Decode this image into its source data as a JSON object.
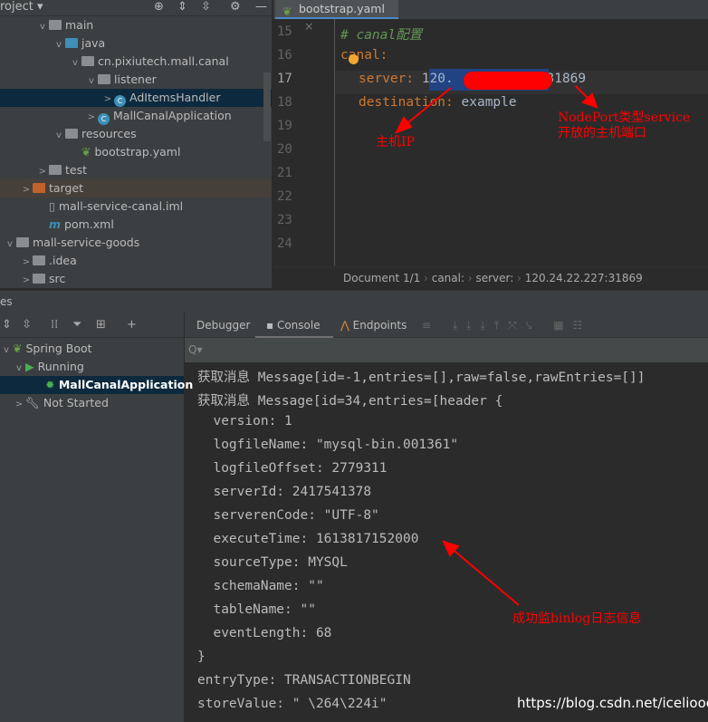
{
  "project": {
    "header": "roject",
    "tree": [
      {
        "label": "main",
        "indent": 40,
        "chev": "v",
        "icon": "folder"
      },
      {
        "label": "java",
        "indent": 58,
        "chev": "v",
        "icon": "folder-blue"
      },
      {
        "label": "cn.pixiutech.mall.canal",
        "indent": 76,
        "chev": "v",
        "icon": "package"
      },
      {
        "label": "listener",
        "indent": 94,
        "chev": "v",
        "icon": "package"
      },
      {
        "label": "AdItemsHandler",
        "indent": 112,
        "chev": ">",
        "icon": "class"
      },
      {
        "label": "MallCanalApplication",
        "indent": 94,
        "chev": ">",
        "icon": "spring-class"
      },
      {
        "label": "resources",
        "indent": 58,
        "chev": "v",
        "icon": "folder"
      },
      {
        "label": "bootstrap.yaml",
        "indent": 76,
        "chev": "",
        "icon": "yaml"
      },
      {
        "label": "test",
        "indent": 40,
        "chev": ">",
        "icon": "folder"
      },
      {
        "label": "target",
        "indent": 22,
        "chev": ">",
        "icon": "folder-orange"
      },
      {
        "label": "mall-service-canal.iml",
        "indent": 40,
        "chev": "",
        "icon": "iml"
      },
      {
        "label": "pom.xml",
        "indent": 40,
        "chev": "",
        "icon": "maven"
      },
      {
        "label": "mall-service-goods",
        "indent": 4,
        "chev": "v",
        "icon": "folder"
      },
      {
        "label": ".idea",
        "indent": 22,
        "chev": ">",
        "icon": "folder"
      },
      {
        "label": "src",
        "indent": 22,
        "chev": ">",
        "icon": "folder"
      }
    ]
  },
  "editor": {
    "tab": "bootstrap.yaml",
    "line_numbers": [
      "15",
      "16",
      "17",
      "18",
      "19",
      "20",
      "21",
      "22",
      "23",
      "24"
    ],
    "comment": "# canal配置",
    "key_canal": "canal:",
    "key_server": "server:",
    "server_visible": "120.",
    "server_port": ":31869",
    "key_destination": "destination:",
    "destination": "example",
    "breadcrumb": [
      "Document 1/1",
      "canal:",
      "server:",
      "120.24.22.227:31869"
    ]
  },
  "annotations": {
    "host_ip": "主机IP",
    "nodeport": "NodePort类型service开放的主机端口",
    "binlog": "成功监binlog日志信息"
  },
  "bottom": {
    "header": "es",
    "services": [
      {
        "label": "Spring Boot"
      },
      {
        "label": "Running"
      },
      {
        "label": "MallCanalApplication"
      },
      {
        "label": "Not Started"
      }
    ],
    "tabs": [
      "Debugger",
      "Console",
      "Endpoints"
    ],
    "active_tab": "Console",
    "console": [
      "获取消息 Message[id=-1,entries=[],raw=false,rawEntries=[]]",
      "获取消息 Message[id=34,entries=[header {",
      "  version: 1",
      "  logfileName: \"mysql-bin.001361\"",
      "  logfileOffset: 2779311",
      "  serverId: 2417541378",
      "  serverenCode: \"UTF-8\"",
      "  executeTime: 1613817152000",
      "  sourceType: MYSQL",
      "  schemaName: \"\"",
      "  tableName: \"\"",
      "  eventLength: 68",
      "}",
      "entryType: TRANSACTIONBEGIN",
      "storeValue: \" \\264\\224i\""
    ]
  },
  "watermark": "https://blog.csdn.net/iceliooo"
}
